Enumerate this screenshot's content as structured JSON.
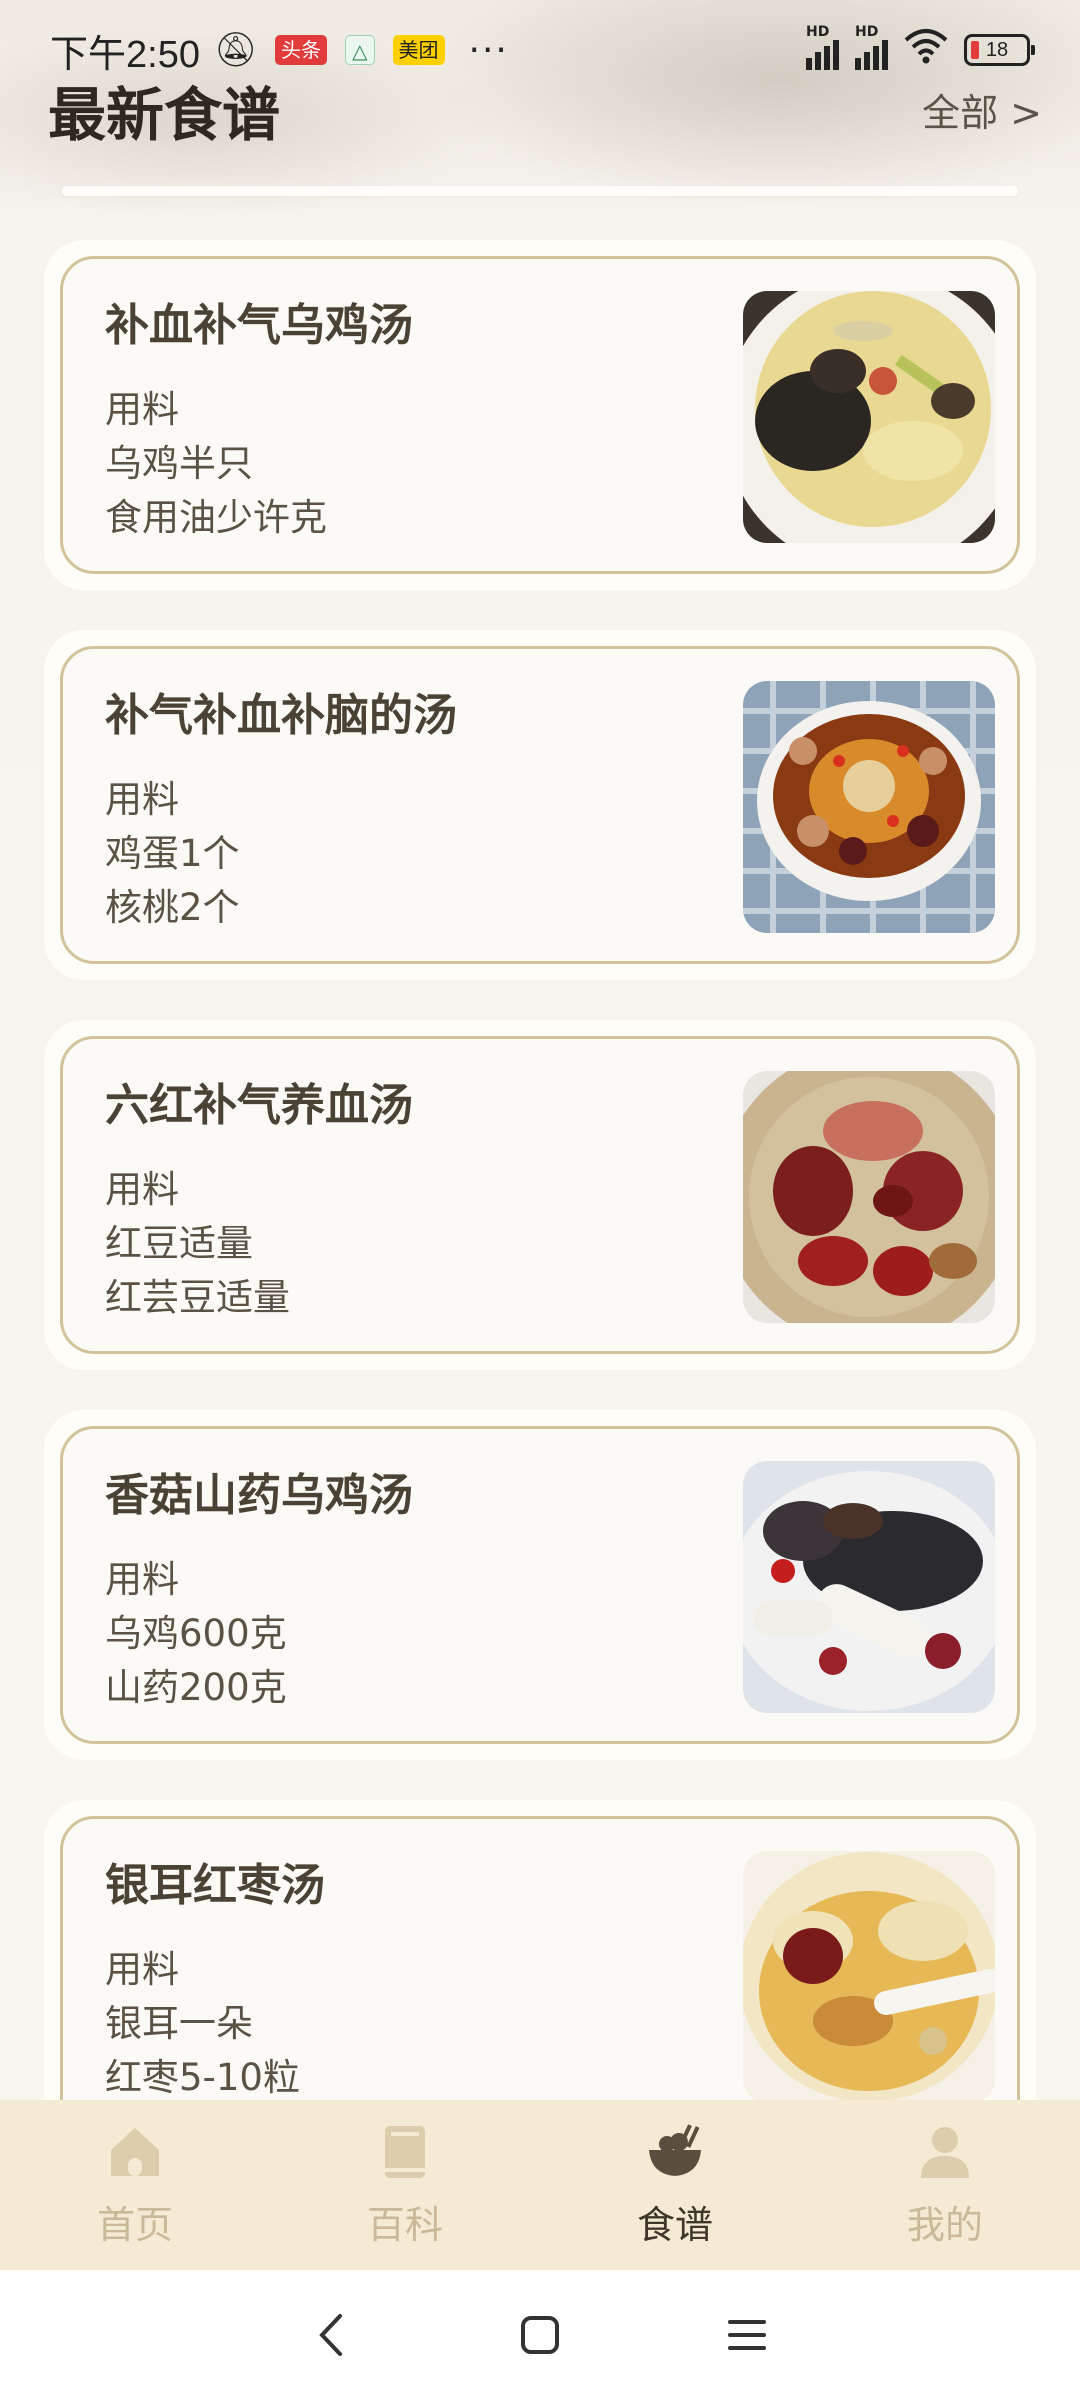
{
  "status_bar": {
    "time": "下午2:50",
    "badges": [
      "头条",
      "△",
      "美团"
    ],
    "more": "···",
    "signal_label": "HD",
    "battery": "18"
  },
  "header": {
    "title": "最新食谱",
    "all_link": "全部 >"
  },
  "recipes": [
    {
      "title": "补血补气乌鸡汤",
      "ingredients_label": "用料",
      "ingredients": [
        "乌鸡半只",
        "食用油少许克"
      ],
      "image": "black-chicken-soup"
    },
    {
      "title": "补气补血补脑的汤",
      "ingredients_label": "用料",
      "ingredients": [
        "鸡蛋1个",
        "核桃2个"
      ],
      "image": "egg-walnut-soup"
    },
    {
      "title": "六红补气养血汤",
      "ingredients_label": "用料",
      "ingredients": [
        "红豆适量",
        "红芸豆适量"
      ],
      "image": "six-red-beans"
    },
    {
      "title": "香菇山药乌鸡汤",
      "ingredients_label": "用料",
      "ingredients": [
        "乌鸡600克",
        "山药200克"
      ],
      "image": "yam-chicken-soup"
    },
    {
      "title": "银耳红枣汤",
      "ingredients_label": "用料",
      "ingredients": [
        "银耳一朵",
        "红枣5-10粒"
      ],
      "image": "tremella-jujube-soup"
    }
  ],
  "tabbar": {
    "items": [
      {
        "label": "首页",
        "icon": "home-icon",
        "active": false
      },
      {
        "label": "百科",
        "icon": "book-icon",
        "active": false
      },
      {
        "label": "食谱",
        "icon": "bowl-icon",
        "active": true
      },
      {
        "label": "我的",
        "icon": "person-icon",
        "active": false
      }
    ]
  },
  "colors": {
    "card_border": "#d2c39a",
    "tab_inactive": "#c9b998",
    "tab_active": "#3f372a",
    "tabbar_bg": "#f5ead3"
  }
}
